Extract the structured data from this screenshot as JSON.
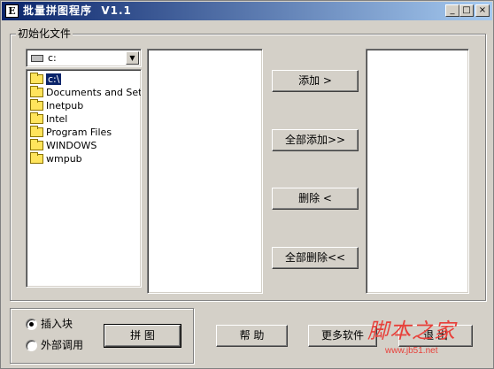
{
  "window": {
    "icon_letter": "E",
    "title": "批量拼图程序  V1.1",
    "controls": {
      "minimize": "_",
      "maximize": "□",
      "close": "×"
    }
  },
  "init_group": {
    "legend": "初始化文件"
  },
  "drive_combo": {
    "icon": "drive-icon",
    "value": "c:",
    "dropdown": "▼"
  },
  "dir_tree": [
    {
      "label": "c:\\",
      "selected": true
    },
    {
      "label": "Documents and Settin"
    },
    {
      "label": "Inetpub"
    },
    {
      "label": "Intel"
    },
    {
      "label": "Program Files"
    },
    {
      "label": "WINDOWS"
    },
    {
      "label": "wmpub"
    }
  ],
  "transfer_buttons": {
    "add": "添加 >",
    "add_all": "全部添加>>",
    "remove": "删除 <",
    "remove_all": "全部删除<<"
  },
  "mode_group": {
    "options": [
      {
        "label": "插入块",
        "checked": true
      },
      {
        "label": "外部调用",
        "checked": false
      }
    ]
  },
  "bottom_buttons": {
    "combine": "拼 图",
    "help": "帮 助",
    "more_software": "更多软件",
    "exit": "退 出"
  },
  "watermark": {
    "main": "脚本之家",
    "url": "www.jb51.net"
  },
  "colors": {
    "titlebar_start": "#0a246a",
    "titlebar_end": "#a6caf0",
    "face": "#d4d0c8",
    "selection": "#0a246a",
    "watermark": "#e8403a"
  }
}
